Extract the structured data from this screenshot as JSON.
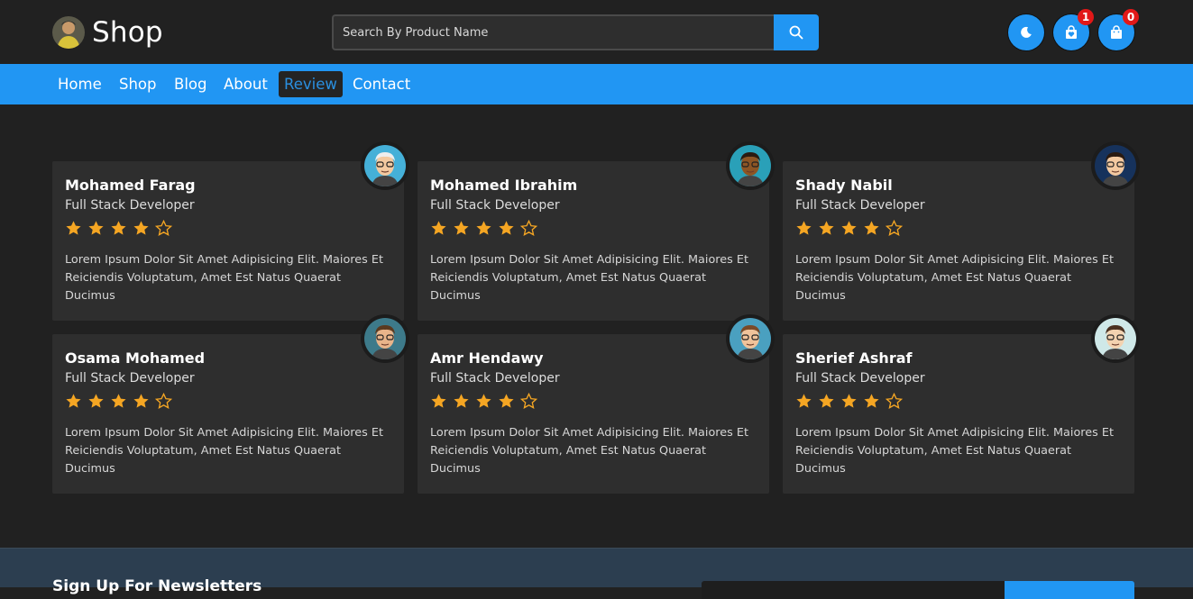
{
  "header": {
    "logo_text": "Shop",
    "search_placeholder": "Search By Product Name",
    "wishlist_count": "1",
    "cart_count": "0"
  },
  "nav": [
    {
      "label": "Home"
    },
    {
      "label": "Shop"
    },
    {
      "label": "Blog"
    },
    {
      "label": "About"
    },
    {
      "label": "Review",
      "active": true
    },
    {
      "label": "Contact"
    }
  ],
  "reviews": [
    {
      "name": "Mohamed Farag",
      "role": "Full Stack Developer",
      "rating": 4,
      "max_rating": 5,
      "text": "Lorem Ipsum Dolor Sit Amet Adipisicing Elit. Maiores Et Reiciendis Voluptatum, Amet Est Natus Quaerat Ducimus",
      "avatar": "old-man-glasses-avatar"
    },
    {
      "name": "Mohamed Ibrahim",
      "role": "Full Stack Developer",
      "rating": 4,
      "max_rating": 5,
      "text": "Lorem Ipsum Dolor Sit Amet Adipisicing Elit. Maiores Et Reiciendis Voluptatum, Amet Est Natus Quaerat Ducimus",
      "avatar": "man-sunglasses-avatar"
    },
    {
      "name": "Shady Nabil",
      "role": "Full Stack Developer",
      "rating": 4,
      "max_rating": 5,
      "text": "Lorem Ipsum Dolor Sit Amet Adipisicing Elit. Maiores Et Reiciendis Voluptatum, Amet Est Natus Quaerat Ducimus",
      "avatar": "man-glasses-avatar"
    },
    {
      "name": "Osama Mohamed",
      "role": "Full Stack Developer",
      "rating": 4,
      "max_rating": 5,
      "text": "Lorem Ipsum Dolor Sit Amet Adipisicing Elit. Maiores Et Reiciendis Voluptatum, Amet Est Natus Quaerat Ducimus",
      "avatar": "young-man-glasses-avatar"
    },
    {
      "name": "Amr Hendawy",
      "role": "Full Stack Developer",
      "rating": 4,
      "max_rating": 5,
      "text": "Lorem Ipsum Dolor Sit Amet Adipisicing Elit. Maiores Et Reiciendis Voluptatum, Amet Est Natus Quaerat Ducimus",
      "avatar": "bearded-man-avatar"
    },
    {
      "name": "Sherief Ashraf",
      "role": "Full Stack Developer",
      "rating": 4,
      "max_rating": 5,
      "text": "Lorem Ipsum Dolor Sit Amet Adipisicing Elit. Maiores Et Reiciendis Voluptatum, Amet Est Natus Quaerat Ducimus",
      "avatar": "man-sunglasses-avatar"
    }
  ],
  "newsletter": {
    "title": "Sign Up For Newsletters"
  },
  "colors": {
    "accent": "#2196f3",
    "background": "#212121",
    "card": "#2e2e2e",
    "star": "#f5a623",
    "badge": "#e21818"
  }
}
